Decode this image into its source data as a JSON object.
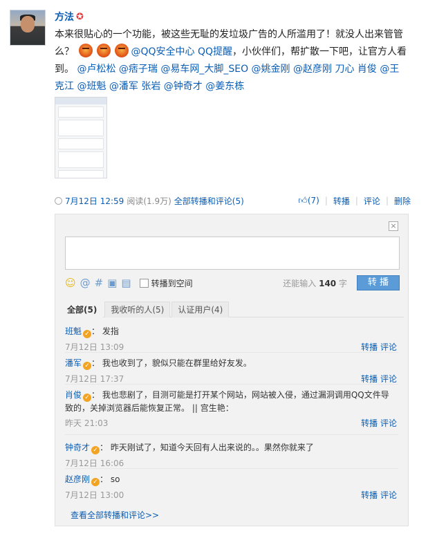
{
  "author": {
    "name": "方法",
    "vip_icon": "vip-star-icon"
  },
  "post": {
    "text_a": "本来很贴心的一个功能，被这些无耻的发垃圾广告的人所滥用了！就没人出来管管么？",
    "emoji_name": "angry-face-icon",
    "mention_links": "@QQ安全中心 QQ提醒",
    "text_b": "，小伙伴们，帮扩散一下吧，让官方人看到。",
    "mentions": "@卢松松 @痞子瑞 @易车网_大脚_SEO @姚金刚 @赵彦刚 刀心 肖俊 @王克江 @班魁 @潘军 张岩 @钟奇才 @姜东栋"
  },
  "meta": {
    "time": "7月12日 12:59",
    "reads": "阅读(1.9万)",
    "all_reposts": "全部转播和评论(5)",
    "likes": "(7)",
    "repost": "转播",
    "comment": "评论",
    "delete": "删除"
  },
  "composer": {
    "share_label": "转播到空间",
    "remain_prefix": "还能输入",
    "remain_count": "140",
    "remain_suffix": "字",
    "submit": "转 播"
  },
  "tabs": [
    {
      "label": "全部(5)"
    },
    {
      "label": "我收听的人(5)"
    },
    {
      "label": "认证用户(4)"
    }
  ],
  "comments": [
    {
      "user": "班魁",
      "text": "发指",
      "time": "7月12日 13:09"
    },
    {
      "user": "潘军",
      "text": "我也收到了，貌似只能在群里给好友发。",
      "time": "7月12日 17:37"
    },
    {
      "user": "肖俊",
      "text": "我也悲剧了，目测可能是打开某个网站，网站被入侵，通过漏洞调用QQ文件导致的，关掉浏览器后能恢复正常。 || 宫生艳：",
      "time": "昨天 21:03"
    },
    {
      "user": "钟奇才",
      "text": "昨天刚试了，知道今天回有人出来说的。。果然你就来了",
      "time": "7月12日 16:06"
    },
    {
      "user": "赵彦刚",
      "text": "so",
      "time": "7月12日 13:00"
    }
  ],
  "comment_actions": {
    "repost": "转播",
    "comment": "评论"
  },
  "view_all": "查看全部转播和评论>>",
  "colors": {
    "link": "#0a5db5",
    "button": "#5b9bd8",
    "panel": "#f2f2f2"
  }
}
